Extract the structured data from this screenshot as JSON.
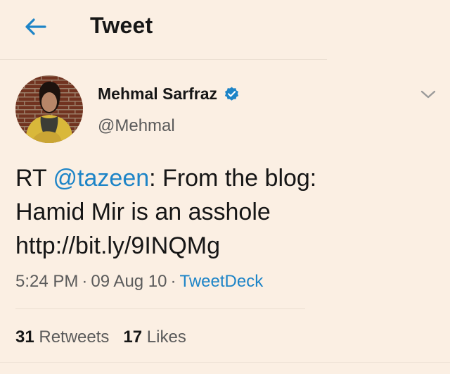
{
  "header": {
    "title": "Tweet",
    "back_icon": "arrow-left-icon"
  },
  "colors": {
    "background": "#fbefe3",
    "accent": "#1d84c7",
    "text": "#161616",
    "muted": "#5b5b5b"
  },
  "tweet": {
    "author": {
      "name": "Mehmal Sarfraz",
      "handle": "@Mehmal",
      "verified": true,
      "verified_icon": "verified-badge-icon"
    },
    "menu_icon": "chevron-down-icon",
    "text": {
      "prefix": "RT ",
      "mention": "@tazeen",
      "line1_rest": ": From the blog:",
      "line2": "Hamid Mir is an asshole",
      "line3": "http://bit.ly/9INQMg"
    },
    "time": "5:24 PM",
    "date": "09 Aug 10",
    "separator": "·",
    "source": "TweetDeck",
    "retweets": {
      "count": "31",
      "label": "Retweets"
    },
    "likes": {
      "count": "17",
      "label": "Likes"
    }
  }
}
